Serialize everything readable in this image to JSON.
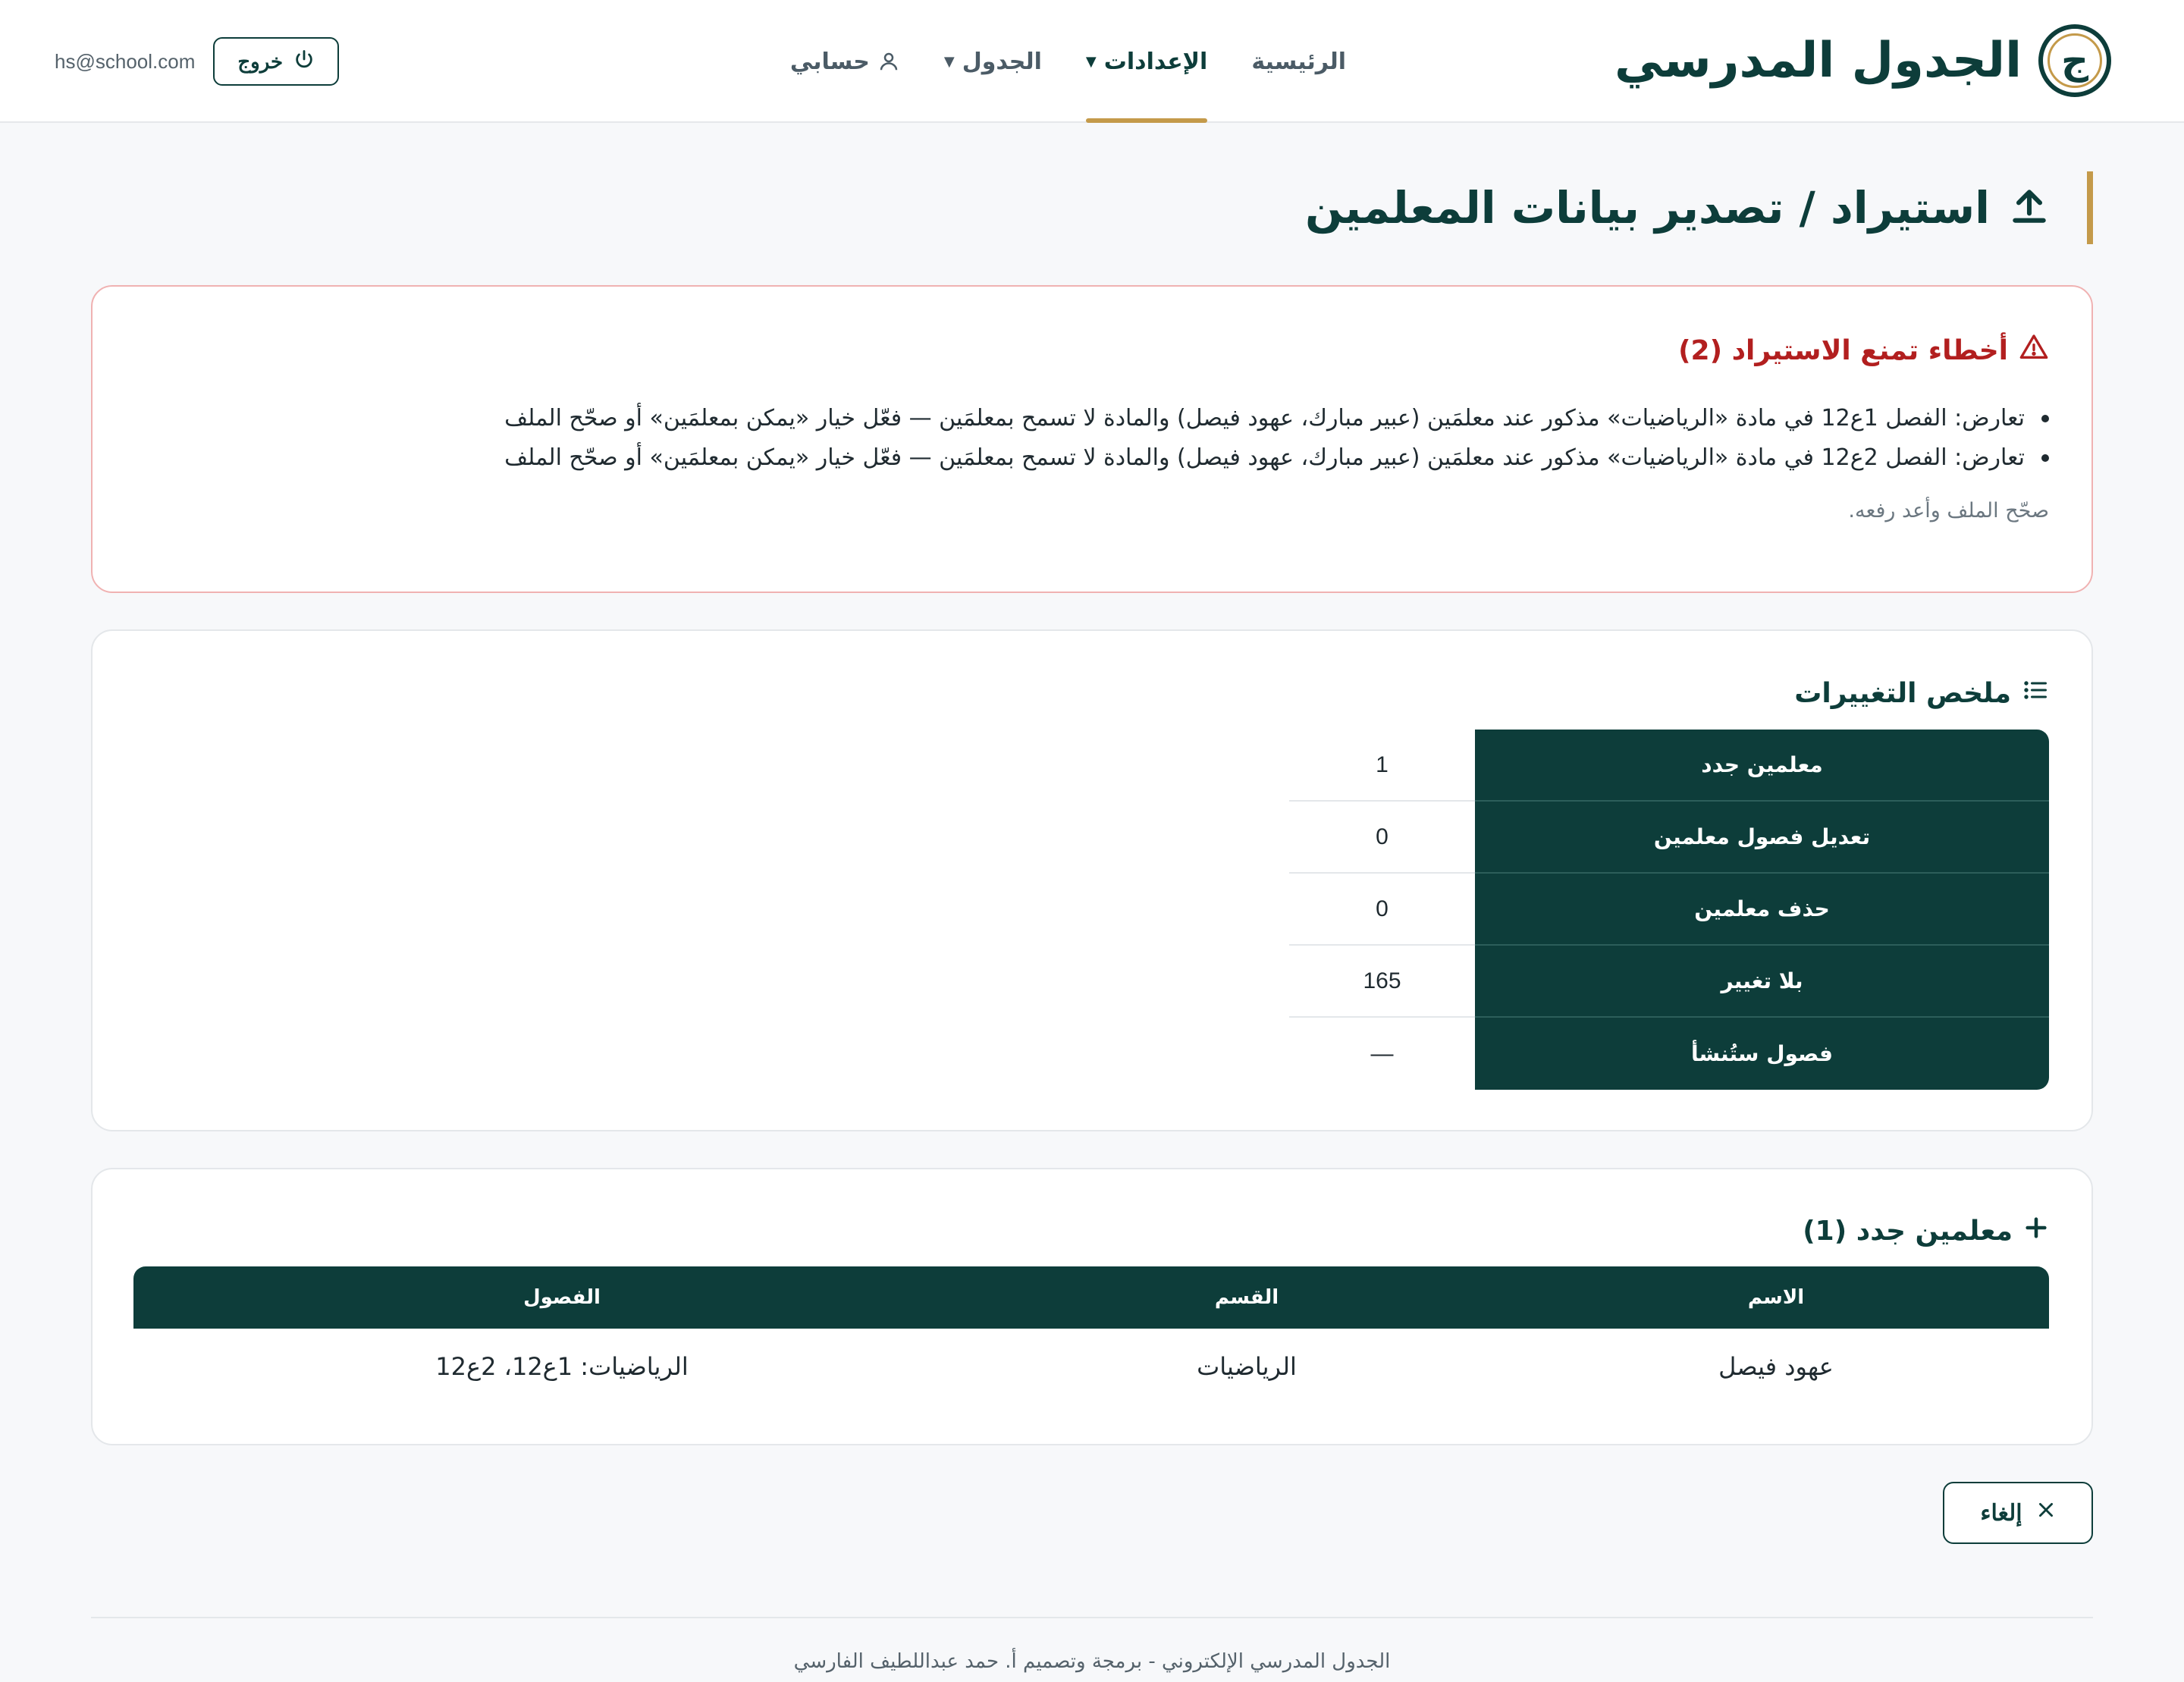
{
  "header": {
    "brand_title": "الجدول المدرسي",
    "brand_logo_letter": "ج",
    "nav": [
      {
        "label": "الرئيسية"
      },
      {
        "label": "الإعدادات"
      },
      {
        "label": "الجدول"
      },
      {
        "label": "حسابي"
      }
    ],
    "active_nav": "الإعدادات",
    "email": "hs@school.com",
    "logout_label": "خروج"
  },
  "page": {
    "title": "استيراد / تصدير بيانات المعلمين"
  },
  "errors": {
    "heading": "أخطاء تمنع الاستيراد (2)",
    "items": [
      "تعارض: الفصل 1ع12 في مادة «الرياضيات» مذكور عند معلمَين (عبير مبارك، عهود فيصل) والمادة لا تسمح بمعلمَين — فعّل خيار «يمكن بمعلمَين» أو صحّح الملف",
      "تعارض: الفصل 2ع12 في مادة «الرياضيات» مذكور عند معلمَين (عبير مبارك، عهود فيصل) والمادة لا تسمح بمعلمَين — فعّل خيار «يمكن بمعلمَين» أو صحّح الملف"
    ],
    "hint": "صحّح الملف وأعد رفعه."
  },
  "summary": {
    "heading": "ملخص التغييرات",
    "rows": [
      {
        "label": "معلمين جدد",
        "value": "1"
      },
      {
        "label": "تعديل فصول معلمين",
        "value": "0"
      },
      {
        "label": "حذف معلمين",
        "value": "0"
      },
      {
        "label": "بلا تغيير",
        "value": "165"
      },
      {
        "label": "فصول ستُنشأ",
        "value": "—"
      }
    ]
  },
  "new_teachers": {
    "heading": "معلمين جدد (1)",
    "columns": [
      "الاسم",
      "القسم",
      "الفصول"
    ],
    "rows": [
      [
        "عهود فيصل",
        "الرياضيات",
        "الرياضيات: 1ع12، 2ع12"
      ]
    ]
  },
  "actions": {
    "cancel_label": "إلغاء"
  },
  "footer": {
    "text": "الجدول المدرسي الإلكتروني - برمجة وتصميم أ. حمد عبداللطيف الفارسي"
  },
  "colors": {
    "primary": "#0d3d3a",
    "accent": "#c49a4a",
    "error": "#b21f1f"
  }
}
